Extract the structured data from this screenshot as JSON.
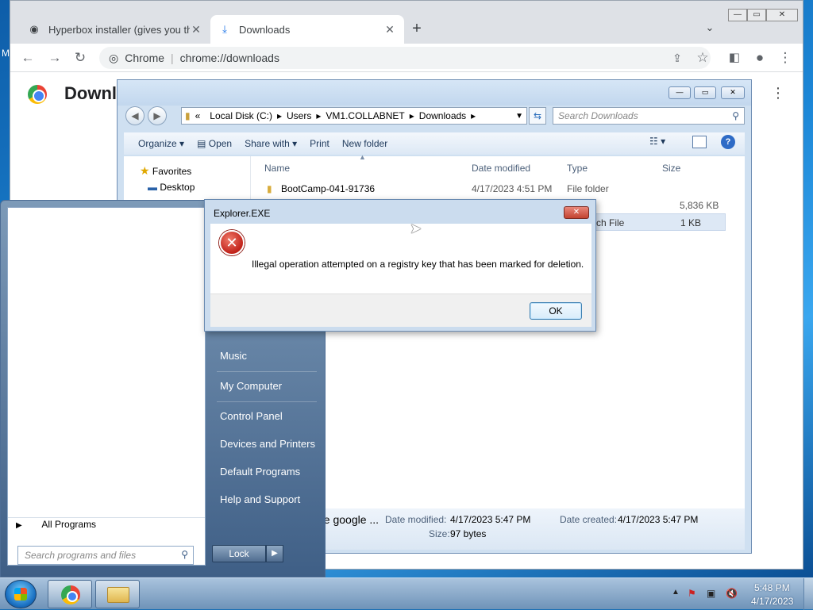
{
  "desktop": {
    "edge_label": "M"
  },
  "chrome": {
    "tabs": [
      {
        "label": "Hyperbox installer (gives you the",
        "icon": "globe-icon"
      },
      {
        "label": "Downloads",
        "icon": "download-icon"
      }
    ],
    "omnibox": {
      "chip": "Chrome",
      "url": "chrome://downloads"
    },
    "page_title": "Downlo"
  },
  "explorer": {
    "breadcrumbs": [
      "«",
      "Local Disk (C:)",
      "Users",
      "VM1.COLLABNET",
      "Downloads"
    ],
    "search_placeholder": "Search Downloads",
    "commands": [
      "Organize",
      "Open",
      "Share with",
      "Print",
      "New folder"
    ],
    "nav": {
      "favorites": "Favorites",
      "desktop": "Desktop"
    },
    "columns": {
      "name": "Name",
      "date": "Date modified",
      "type": "Type",
      "size": "Size"
    },
    "files": [
      {
        "name": "BootCamp-041-91736",
        "date": "4/17/2023 4:51 PM",
        "type": "File folder",
        "size": ""
      },
      {
        "name": "",
        "date": "",
        "type": "ation",
        "size": "5,836 KB"
      },
      {
        "name": "",
        "date": "",
        "type": "ws Batch File",
        "size": "1 KB"
      }
    ],
    "details": {
      "name_fragment": "he google ...",
      "date_modified_label": "Date modified:",
      "date_modified": "4/17/2023 5:47 PM",
      "date_created_label": "Date created:",
      "date_created": "4/17/2023 5:47 PM",
      "size_label": "Size:",
      "size": "97 bytes"
    }
  },
  "startmenu": {
    "right_items": [
      "Music",
      "My Computer",
      "Control Panel",
      "Devices and Printers",
      "Default Programs",
      "Help and Support"
    ],
    "all_programs": "All Programs",
    "search_placeholder": "Search programs and files",
    "lock_label": "Lock"
  },
  "dialog": {
    "title": "Explorer.EXE",
    "message": "Illegal operation attempted on a registry key that has been marked for deletion.",
    "ok_label": "OK",
    "icon": "error-icon"
  },
  "taskbar": {
    "time": "5:48 PM",
    "date": "4/17/2023",
    "pinned": [
      "chrome-icon",
      "explorer-icon"
    ]
  },
  "colors": {
    "accent": "#1a6fb5",
    "error": "#c1221a"
  }
}
